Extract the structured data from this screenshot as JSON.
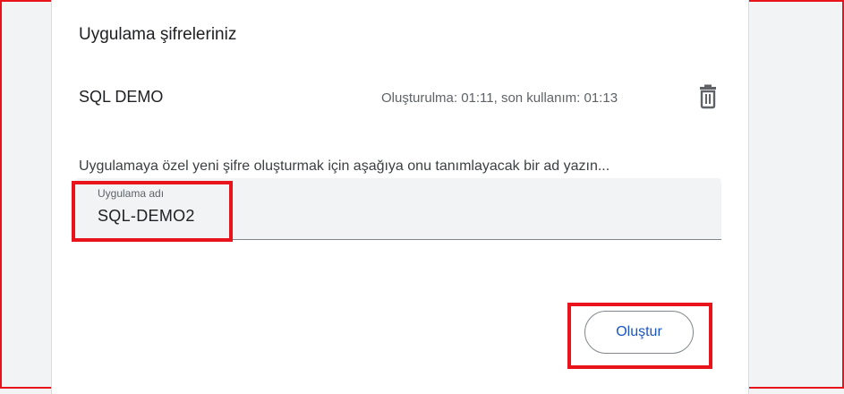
{
  "section": {
    "title": "Uygulama şifreleriniz"
  },
  "app_passwords": [
    {
      "name": "SQL DEMO",
      "meta": "Oluşturulma: 01:11, son kullanım: 01:13",
      "delete_icon": "trash-icon"
    }
  ],
  "new_password": {
    "hint": "Uygulamaya özel yeni şifre oluşturmak için aşağıya onu tanımlayacak bir ad yazın...",
    "field_label": "Uygulama adı",
    "field_value": "SQL-DEMO2",
    "create_label": "Oluştur"
  },
  "colors": {
    "accent": "#1a56c4",
    "highlight": "#e8131b"
  }
}
